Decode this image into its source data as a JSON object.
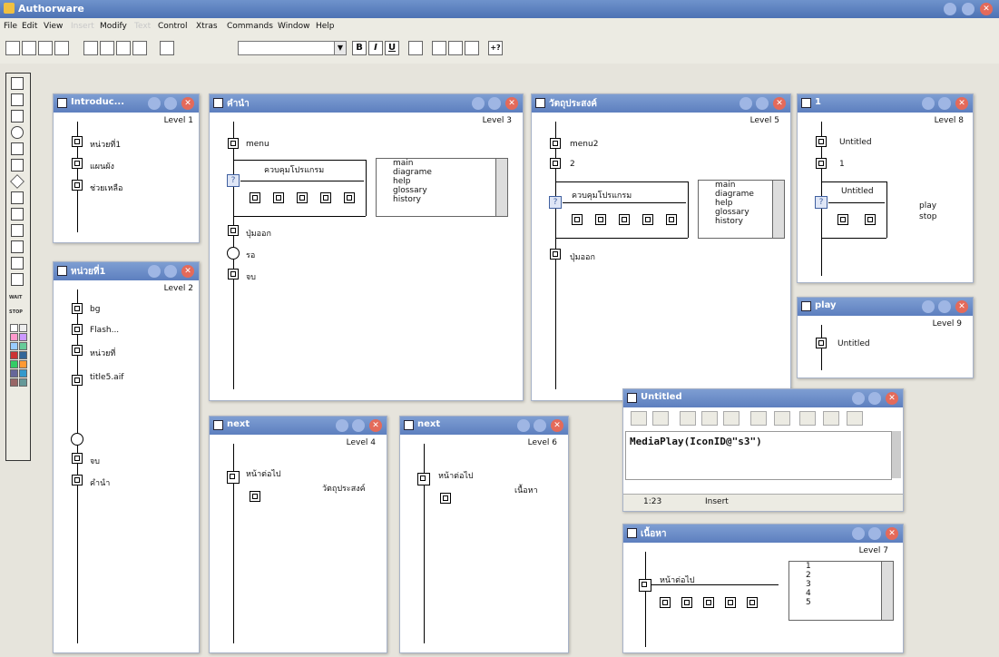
{
  "app": {
    "title": "Authorware"
  },
  "menu": [
    {
      "label": "File",
      "enabled": true
    },
    {
      "label": "Edit",
      "enabled": true
    },
    {
      "label": "View",
      "enabled": true
    },
    {
      "label": "Insert",
      "enabled": false
    },
    {
      "label": "Modify",
      "enabled": true
    },
    {
      "label": "Text",
      "enabled": false
    },
    {
      "label": "Control",
      "enabled": true
    },
    {
      "label": "Xtras",
      "enabled": true
    },
    {
      "label": "Commands",
      "enabled": true
    },
    {
      "label": "Window",
      "enabled": true
    },
    {
      "label": "Help",
      "enabled": true
    }
  ],
  "toolbar": {
    "bold": "B",
    "italic": "I",
    "underline": "U",
    "help": "+?"
  },
  "palette": {
    "wait_label": "WAIT",
    "stop_label": "STOP"
  },
  "windows": {
    "introduction": {
      "title": "Introduc...",
      "level": "Level 1",
      "items": [
        "หน่วยที่1",
        "แผนผัง",
        "ช่วยเหลือ"
      ]
    },
    "unit1": {
      "title": "หน่วยที่1",
      "level": "Level 2",
      "items": [
        "bg",
        "Flash...",
        "หน่วยที่",
        "title5.aif",
        "จบ",
        "คำนำ"
      ]
    },
    "main": {
      "title": "คำนำ",
      "level": "Level 3",
      "menu": "menu",
      "control": "ควบคุมโปรแกรม",
      "list": [
        "main",
        "diagrame",
        "help",
        "glossary",
        "history"
      ],
      "exit": "ปุ่มออก",
      "wait": "รอ",
      "end": "จบ"
    },
    "next1": {
      "title": "next",
      "level": "Level 4",
      "item": "หน้าต่อไป",
      "target": "วัตถุประสงค์"
    },
    "objective": {
      "title": "วัตถุประสงค์",
      "level": "Level 5",
      "menu": "menu2",
      "num": "2",
      "control": "ควบคุมโปรแกรม",
      "list": [
        "main",
        "diagrame",
        "help",
        "glossary",
        "history"
      ],
      "exit": "ปุ่มออก"
    },
    "next2": {
      "title": "next",
      "level": "Level 6",
      "item": "หน้าต่อไป",
      "target": "เนื้อหา"
    },
    "content": {
      "title": "เนื้อหา",
      "level": "Level 7",
      "item": "หน้าต่อไป",
      "list": [
        "1",
        "2",
        "3",
        "4",
        "5"
      ]
    },
    "one": {
      "title": "1",
      "level": "Level 8",
      "items": [
        "Untitled",
        "1",
        "Untitled"
      ],
      "list": [
        "play",
        "stop"
      ]
    },
    "play": {
      "title": "play",
      "level": "Level 9",
      "item": "Untitled"
    },
    "untitled": {
      "title": "Untitled",
      "code": "MediaPlay(IconID@\"s3\")",
      "position": "1:23",
      "mode": "Insert"
    }
  }
}
